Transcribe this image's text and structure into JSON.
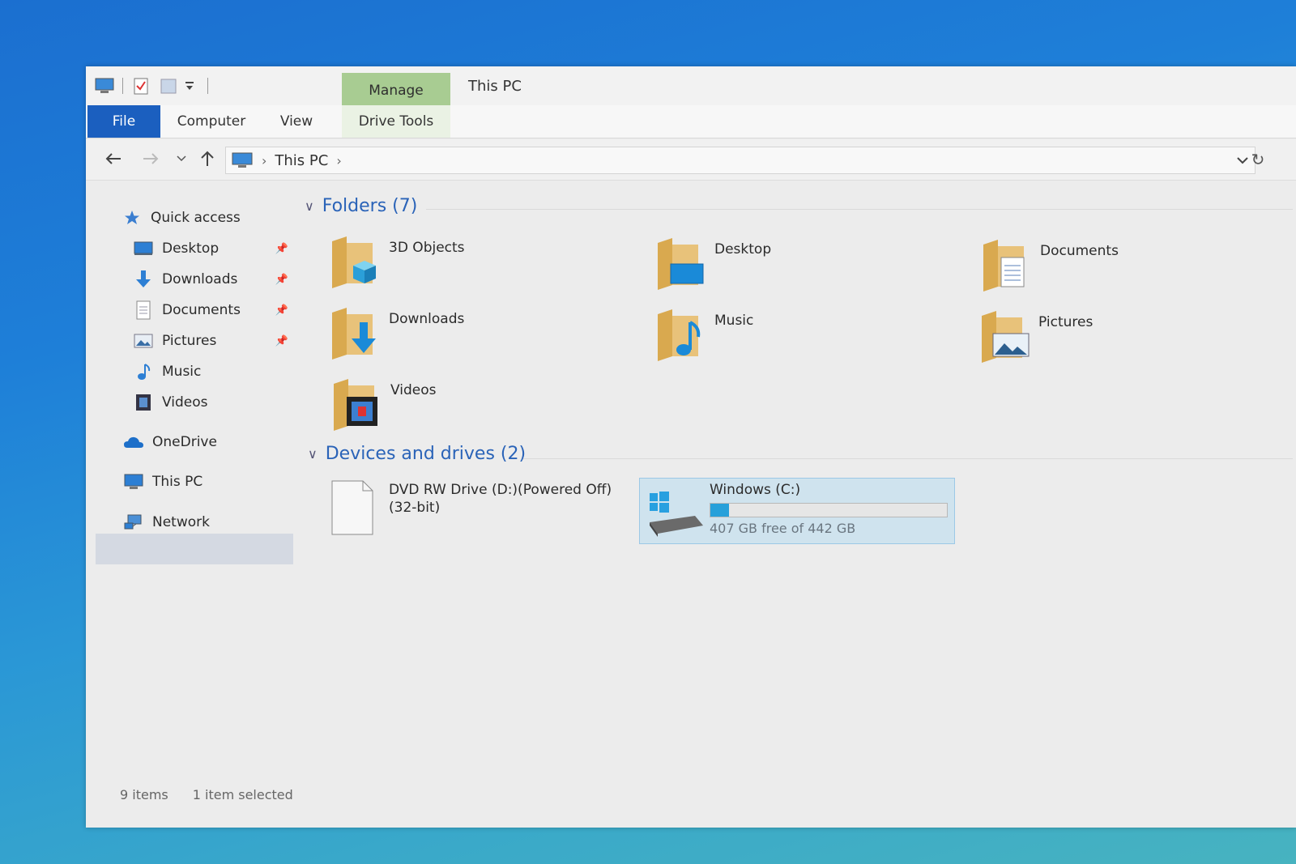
{
  "window": {
    "title": "This PC",
    "contextual_tab": "Manage",
    "ribbon_tabs": [
      "File",
      "Computer",
      "View",
      "Drive Tools"
    ]
  },
  "address": {
    "location": "This PC"
  },
  "nav": {
    "quick_access": "Quick access",
    "items": [
      {
        "label": "Desktop",
        "pinned": true
      },
      {
        "label": "Downloads",
        "pinned": true
      },
      {
        "label": "Documents",
        "pinned": true
      },
      {
        "label": "Pictures",
        "pinned": true
      },
      {
        "label": "Music",
        "pinned": false
      },
      {
        "label": "Videos",
        "pinned": false
      }
    ],
    "onedrive": "OneDrive",
    "this_pc": "This PC",
    "network": "Network"
  },
  "folders": {
    "heading": "Folders (7)",
    "items": [
      "3D Objects",
      "Desktop",
      "Documents",
      "Downloads",
      "Music",
      "Pictures",
      "Videos"
    ]
  },
  "devices": {
    "heading": "Devices and drives (2)",
    "dvd": {
      "name_line1": "DVD RW Drive (D:)(Powered Off)",
      "name_line2": "(32-bit)"
    },
    "c_drive": {
      "name": "Windows (C:)",
      "free_text": "407 GB free of 442 GB",
      "used_fraction": 0.079
    }
  },
  "status": {
    "items": "9 items",
    "selected": "1 item selected"
  },
  "colors": {
    "accent": "#1b5fbf",
    "link_blue": "#2a63b8",
    "manage_green": "#a8cc92",
    "drive_bar": "#26a0da"
  }
}
